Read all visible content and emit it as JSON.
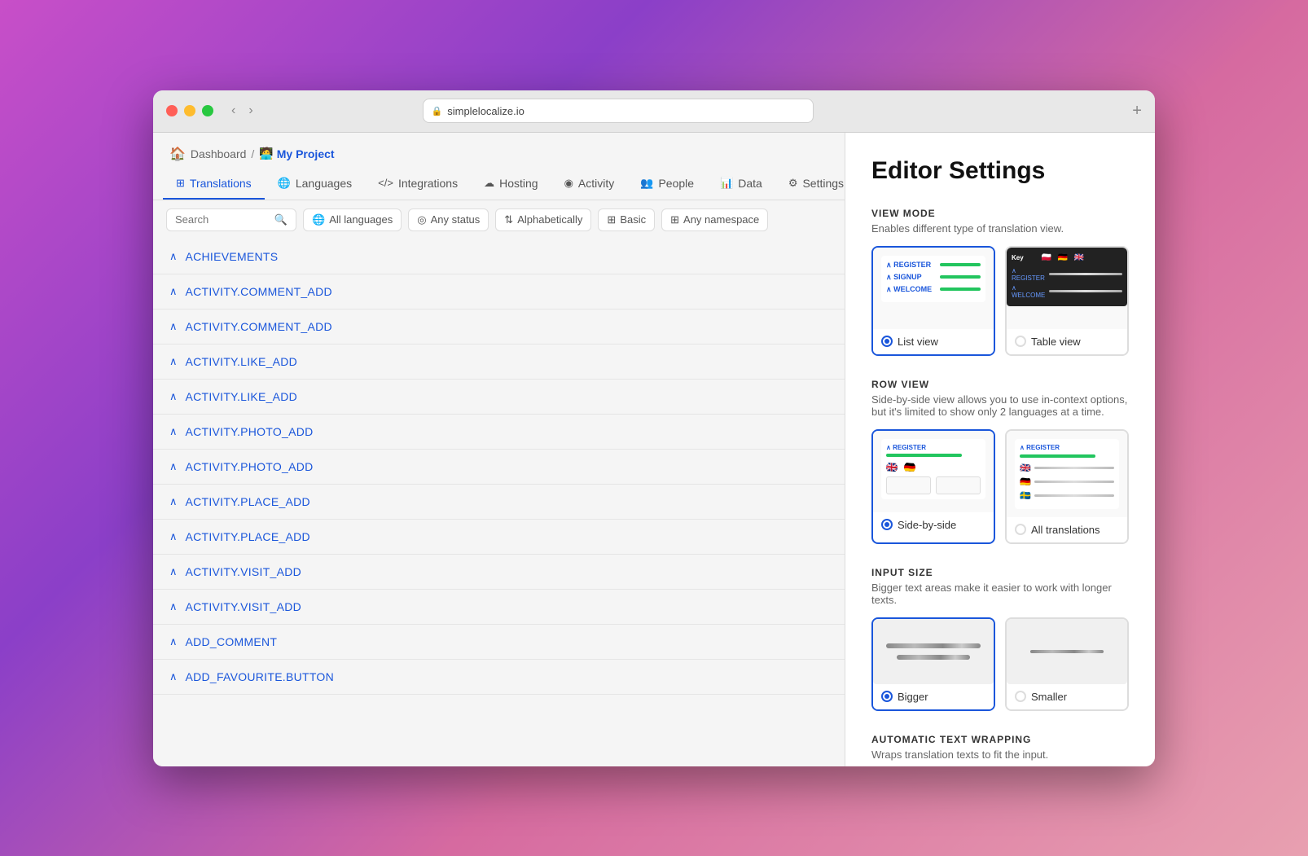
{
  "window": {
    "url": "simplelocalize.io",
    "new_tab_label": "+"
  },
  "breadcrumb": {
    "home_icon": "🏠",
    "dashboard_label": "Dashboard",
    "separator": "/",
    "project_icon": "🧑‍💻",
    "project_name": "My Project"
  },
  "nav_tabs": [
    {
      "id": "translations",
      "label": "Translations",
      "icon": "⊞",
      "active": true
    },
    {
      "id": "languages",
      "label": "Languages",
      "icon": "🌐",
      "active": false
    },
    {
      "id": "integrations",
      "label": "Integrations",
      "icon": "</>",
      "active": false
    },
    {
      "id": "hosting",
      "label": "Hosting",
      "icon": "☁",
      "active": false
    },
    {
      "id": "activity",
      "label": "Activity",
      "icon": "((●))",
      "active": false
    },
    {
      "id": "people",
      "label": "People",
      "icon": "⚙",
      "active": false
    },
    {
      "id": "data",
      "label": "Data",
      "icon": "📊",
      "active": false
    },
    {
      "id": "settings",
      "label": "Settings",
      "icon": "⚙",
      "active": false
    }
  ],
  "toolbar": {
    "search_placeholder": "Search",
    "filters": [
      {
        "id": "languages",
        "label": "All languages",
        "icon": "🌐"
      },
      {
        "id": "status",
        "label": "Any status",
        "icon": "◎"
      },
      {
        "id": "sort",
        "label": "Alphabetically",
        "icon": "⇅"
      },
      {
        "id": "view",
        "label": "Basic",
        "icon": "⊞"
      },
      {
        "id": "namespace",
        "label": "Any namespace",
        "icon": "⊞"
      }
    ]
  },
  "translation_keys": [
    "ACHIEVEMENTS",
    "ACTIVITY.COMMENT_ADD",
    "ACTIVITY.COMMENT_ADD",
    "ACTIVITY.LIKE_ADD",
    "ACTIVITY.LIKE_ADD",
    "ACTIVITY.PHOTO_ADD",
    "ACTIVITY.PHOTO_ADD",
    "ACTIVITY.PLACE_ADD",
    "ACTIVITY.PLACE_ADD",
    "ACTIVITY.VISIT_ADD",
    "ACTIVITY.VISIT_ADD",
    "ADD_COMMENT",
    "ADD_FAVOURITE.BUTTON"
  ],
  "editor": {
    "title": "Editor Settings",
    "view_mode": {
      "heading": "VIEW MODE",
      "description": "Enables different type of translation view.",
      "options": [
        {
          "id": "list",
          "label": "List view",
          "selected": true
        },
        {
          "id": "table",
          "label": "Table view",
          "selected": false
        }
      ]
    },
    "row_view": {
      "heading": "ROW VIEW",
      "description": "Side-by-side view allows you to use in-context options, but it's limited to show only 2 languages at a time.",
      "options": [
        {
          "id": "sidebyside",
          "label": "Side-by-side",
          "selected": true
        },
        {
          "id": "alltranslations",
          "label": "All translations",
          "selected": false
        }
      ]
    },
    "input_size": {
      "heading": "INPUT SIZE",
      "description": "Bigger text areas make it easier to work with longer texts.",
      "options": [
        {
          "id": "bigger",
          "label": "Bigger",
          "selected": true
        },
        {
          "id": "smaller",
          "label": "Smaller",
          "selected": false
        }
      ]
    },
    "auto_wrap": {
      "heading": "AUTOMATIC TEXT WRAPPING",
      "description": "Wraps translation texts to fit the input."
    }
  }
}
